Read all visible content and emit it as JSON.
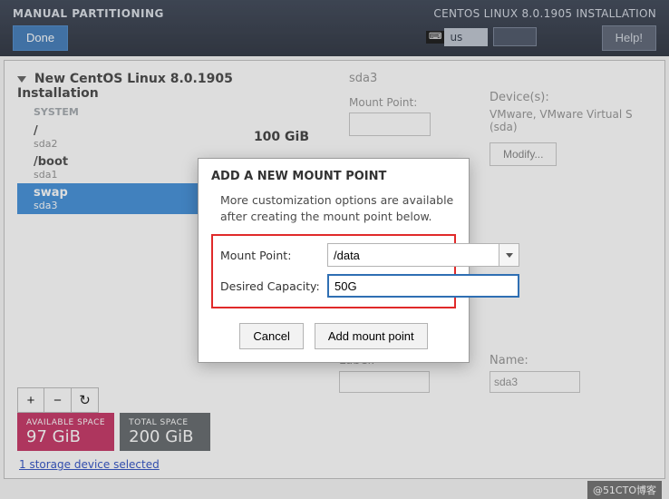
{
  "header": {
    "title_left": "MANUAL PARTITIONING",
    "title_right": "CENTOS LINUX 8.0.1905 INSTALLATION",
    "done_label": "Done",
    "help_label": "Help!",
    "lang_code": "us"
  },
  "install": {
    "title": "New CentOS Linux 8.0.1905 Installation",
    "section_label": "SYSTEM",
    "partitions": [
      {
        "mount": "/",
        "device": "sda2",
        "size": "100 GiB",
        "selected": false
      },
      {
        "mount": "/boot",
        "device": "sda1",
        "size": "",
        "selected": false
      },
      {
        "mount": "swap",
        "device": "sda3",
        "size": "",
        "selected": true
      }
    ],
    "buttons": {
      "add": "+",
      "remove": "−",
      "reload": "↻"
    },
    "space": {
      "avail_label": "AVAILABLE SPACE",
      "avail_val": "97 GiB",
      "total_label": "TOTAL SPACE",
      "total_val": "200 GiB"
    },
    "storage_link": "1 storage device selected"
  },
  "right": {
    "selected_name": "sda3",
    "mount_label": "Mount Point:",
    "devices_label": "Device(s):",
    "device_desc": "VMware, VMware Virtual S (sda)",
    "modify_label": "Modify...",
    "label_label": "Label:",
    "name_label": "Name:",
    "name_value": "sda3"
  },
  "dialog": {
    "title": "ADD A NEW MOUNT POINT",
    "desc": "More customization options are available after creating the mount point below.",
    "mount_label": "Mount Point:",
    "mount_value": "/data",
    "capacity_label": "Desired Capacity:",
    "capacity_value": "50G",
    "cancel_label": "Cancel",
    "add_label": "Add mount point"
  },
  "footer": {
    "watermark": "@51CTO博客"
  }
}
